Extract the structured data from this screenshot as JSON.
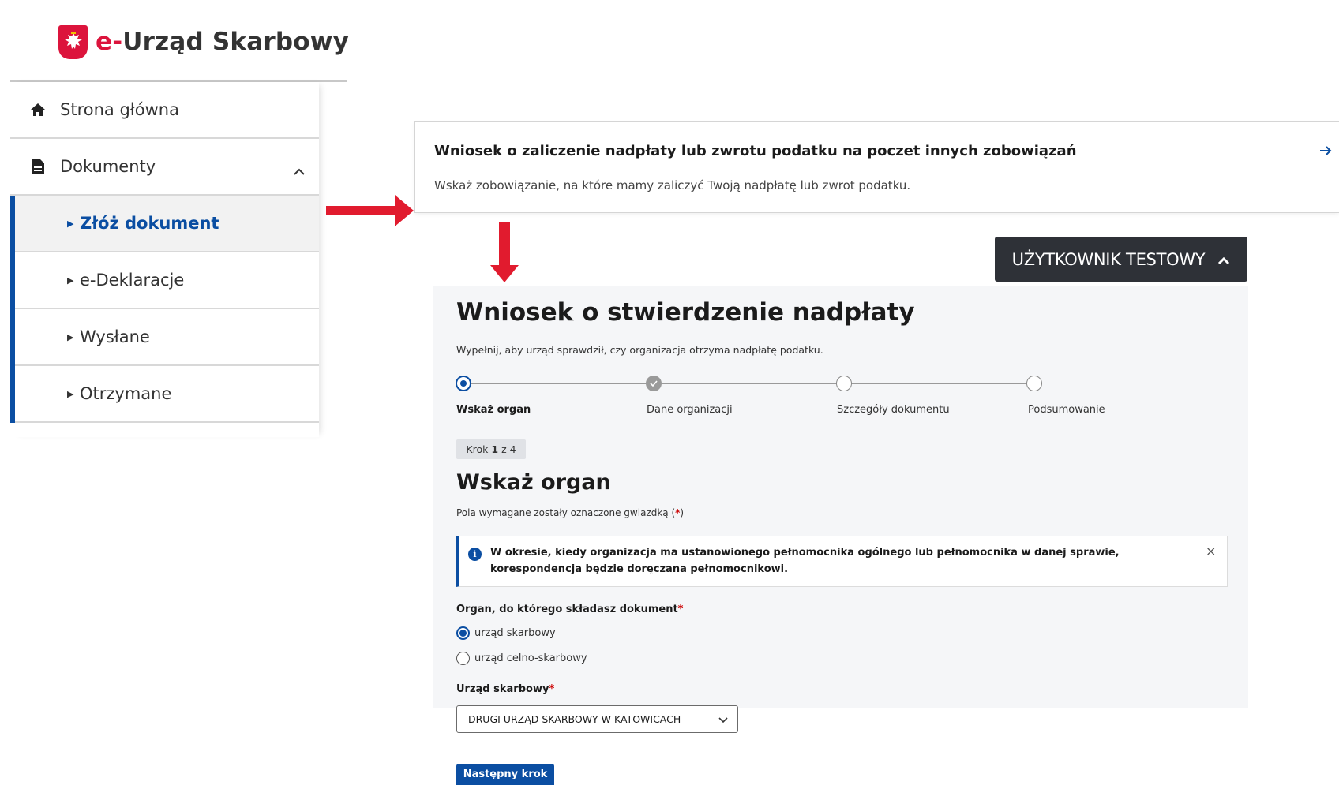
{
  "app": {
    "logo_prefix": "e-",
    "logo_name": "Urząd Skarbowy"
  },
  "sidebar": {
    "items": [
      {
        "label": "Strona główna",
        "icon": "home-icon"
      },
      {
        "label": "Dokumenty",
        "icon": "document-icon",
        "expanded": true
      }
    ],
    "subitems": [
      {
        "label": "Złóż dokument",
        "active": true
      },
      {
        "label": "e-Deklaracje"
      },
      {
        "label": "Wysłane"
      },
      {
        "label": "Otrzymane"
      }
    ]
  },
  "card": {
    "title": "Wniosek o zaliczenie nadpłaty lub zwrotu podatku na poczet innych zobowiązań",
    "description": "Wskaż zobowiązanie, na które mamy zaliczyć Twoją nadpłatę lub zwrot podatku.",
    "arrow_icon": "arrow-right-icon"
  },
  "user_menu": {
    "label": "UŻYTKOWNIK TESTOWY",
    "icon": "chevron-up-icon"
  },
  "form": {
    "title": "Wniosek o stwierdzenie nadpłaty",
    "lead": "Wypełnij, aby urząd sprawdził, czy organizacja otrzyma nadpłatę podatku.",
    "steps": [
      {
        "label": "Wskaż organ",
        "state": "current"
      },
      {
        "label": "Dane organizacji",
        "state": "done"
      },
      {
        "label": "Szczegóły dokumentu",
        "state": "todo"
      },
      {
        "label": "Podsumowanie",
        "state": "todo"
      }
    ],
    "step_counter": {
      "prefix": "Krok",
      "current": "1",
      "separator": "z",
      "total": "4"
    },
    "section_title": "Wskaż organ",
    "required_note": "Pola wymagane zostały oznaczone gwiazdką (",
    "required_star": "*",
    "required_close": ")",
    "info": {
      "text": "W okresie, kiedy organizacja ma ustanowionego pełnomocnika ogólnego lub pełnomocnika w danej sprawie, korespondencja będzie doręczana pełnomocnikowi.",
      "icon_glyph": "i",
      "close_glyph": "×"
    },
    "organ_label": "Organ, do którego składasz dokument",
    "organ_options": [
      {
        "label": "urząd skarbowy",
        "selected": true
      },
      {
        "label": "urząd celno-skarbowy",
        "selected": false
      }
    ],
    "office_label": "Urząd skarbowy",
    "office_value": "DRUGI URZĄD SKARBOWY W KATOWICACH",
    "star": "*",
    "next_button": "Następny krok"
  },
  "colors": {
    "primary": "#0b4ea2",
    "brand_red": "#dc143c",
    "arrow_red": "#e11b2e",
    "dark_button": "#2e3137",
    "panel_bg": "#f5f6f8"
  }
}
